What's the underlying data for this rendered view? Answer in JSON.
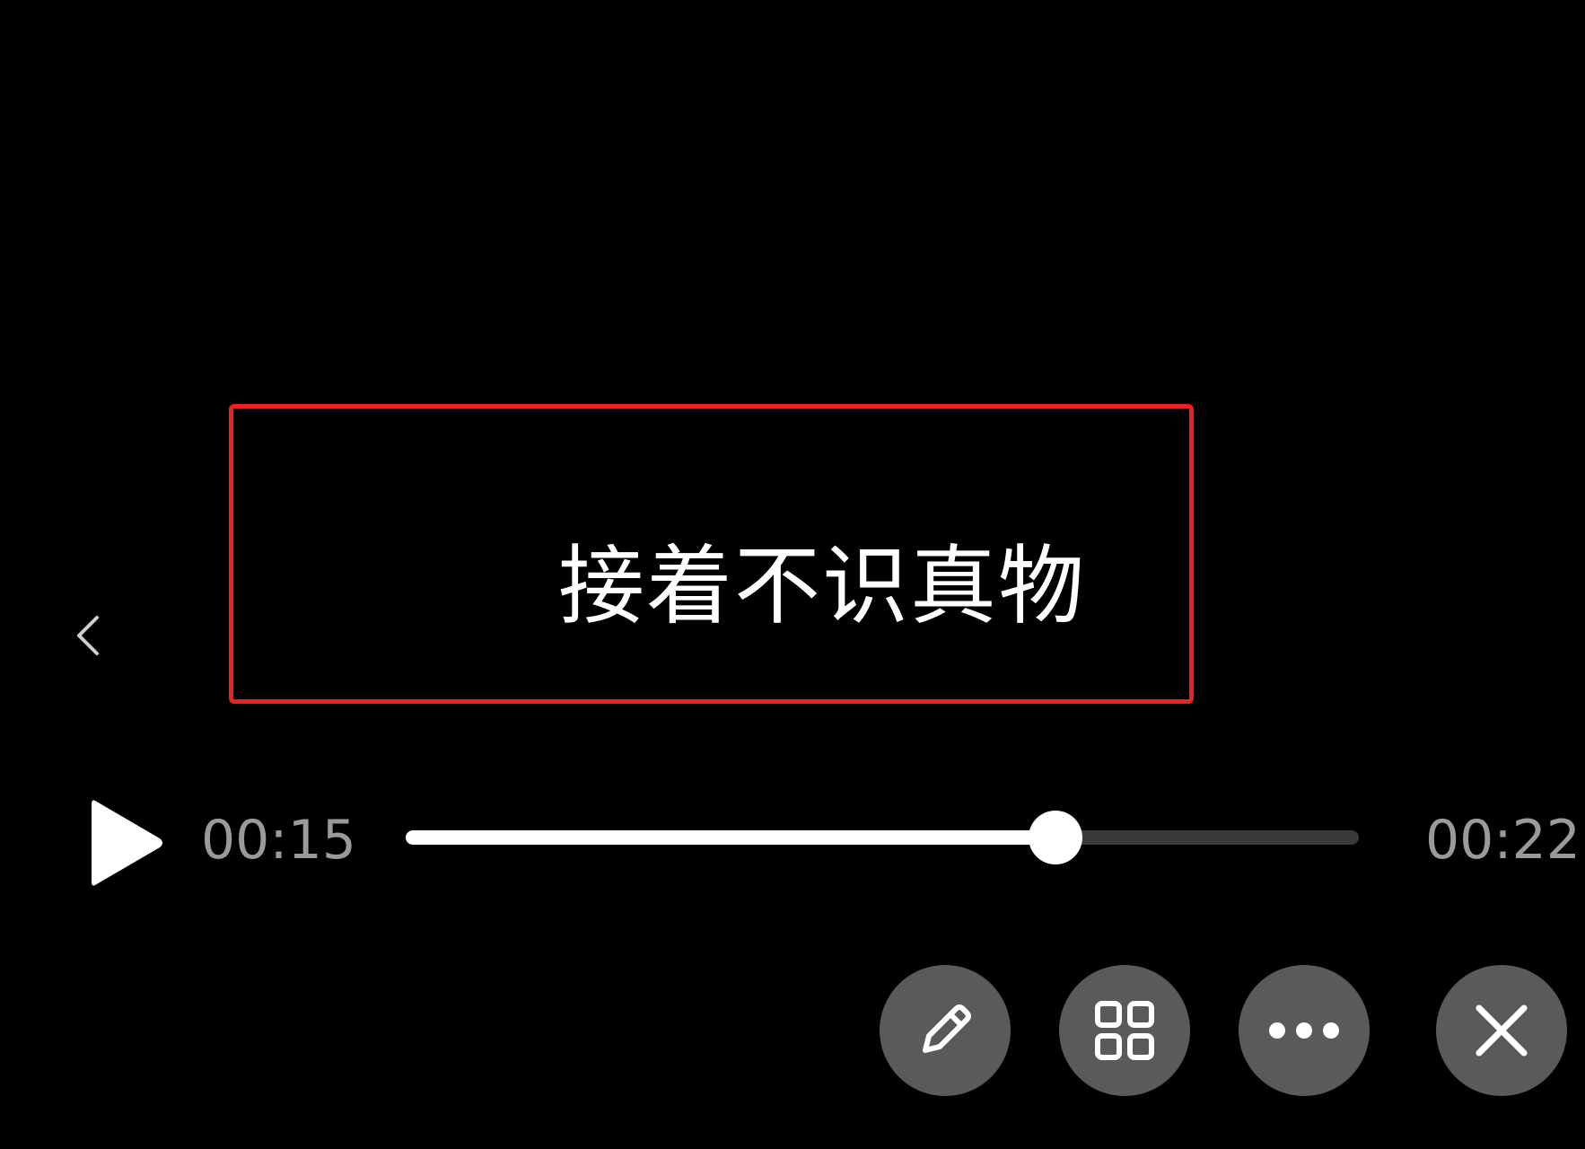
{
  "player": {
    "subtitle": "接着不识真物",
    "current_time": "00:15",
    "total_time": "00:22",
    "progress": 0.682
  },
  "colors": {
    "background": "#000000",
    "highlight_border": "#e8231f",
    "button_bg": "#5a5a5a",
    "time_text": "#9a9a9a"
  },
  "icons": {
    "back": "chevron-left-icon",
    "play": "play-icon",
    "edit": "pencil-icon",
    "grid": "grid-icon",
    "more": "more-dots-icon",
    "close": "close-icon"
  }
}
